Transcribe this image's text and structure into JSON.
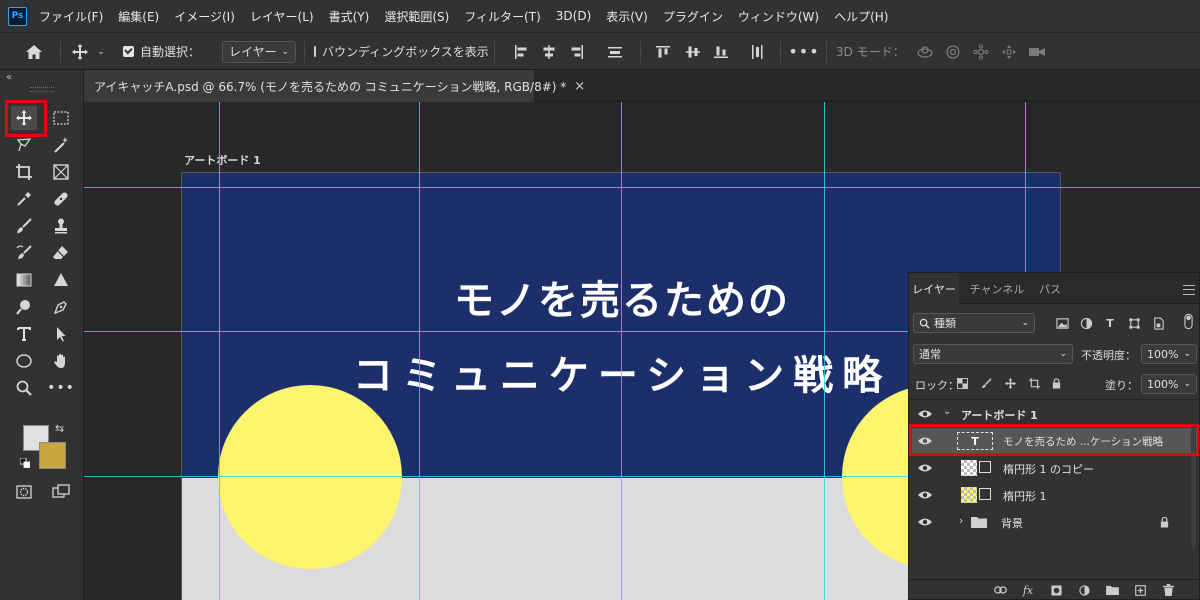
{
  "menu": {
    "app_logo": "Ps",
    "items": [
      "ファイル(F)",
      "編集(E)",
      "イメージ(I)",
      "レイヤー(L)",
      "書式(Y)",
      "選択範囲(S)",
      "フィルター(T)",
      "3D(D)",
      "表示(V)",
      "プラグイン",
      "ウィンドウ(W)",
      "ヘルプ(H)"
    ]
  },
  "options": {
    "auto_select_label": "自動選択：",
    "auto_select_checked": true,
    "auto_select_target": "レイヤー",
    "bounding_box_label": "バウンディングボックスを表示",
    "bounding_box_checked": false,
    "mode_3d_label": "3D モード："
  },
  "document": {
    "tab_title": "アイキャッチA.psd @ 66.7% (モノを売るための コミュニケーション戦略, RGB/8#) *",
    "close_glyph": "×"
  },
  "canvas": {
    "artboard_label": "アートボード 1",
    "headline_line1": "モノを売るための",
    "headline_line2": "コミュニケーション戦略",
    "colors": {
      "banner": "#1c2f6b",
      "circle": "#fcf56e",
      "lower": "#dcdcdc",
      "guide": "#27d6e3"
    }
  },
  "tools": {
    "active_tool": "move-tool",
    "foreground_color": "#e0e0e0",
    "background_color": "#c8a53e"
  },
  "layers_panel": {
    "tabs": [
      "レイヤー",
      "チャンネル",
      "パス"
    ],
    "active_tab": "レイヤー",
    "filter_label": "種類",
    "blend_mode": "通常",
    "opacity_label": "不透明度：",
    "opacity_value": "100%",
    "lock_label": "ロック：",
    "fill_label": "塗り：",
    "fill_value": "100%",
    "layers": [
      {
        "name": "アートボード 1",
        "type": "artboard"
      },
      {
        "name": "モノを売るため ...ケーション戦略",
        "type": "text",
        "selected": true
      },
      {
        "name": "楕円形 1 のコピー",
        "type": "shape"
      },
      {
        "name": "楕円形 1",
        "type": "shape"
      },
      {
        "name": "背景",
        "type": "group",
        "locked": true
      }
    ],
    "text_thumb_glyph": "T"
  }
}
